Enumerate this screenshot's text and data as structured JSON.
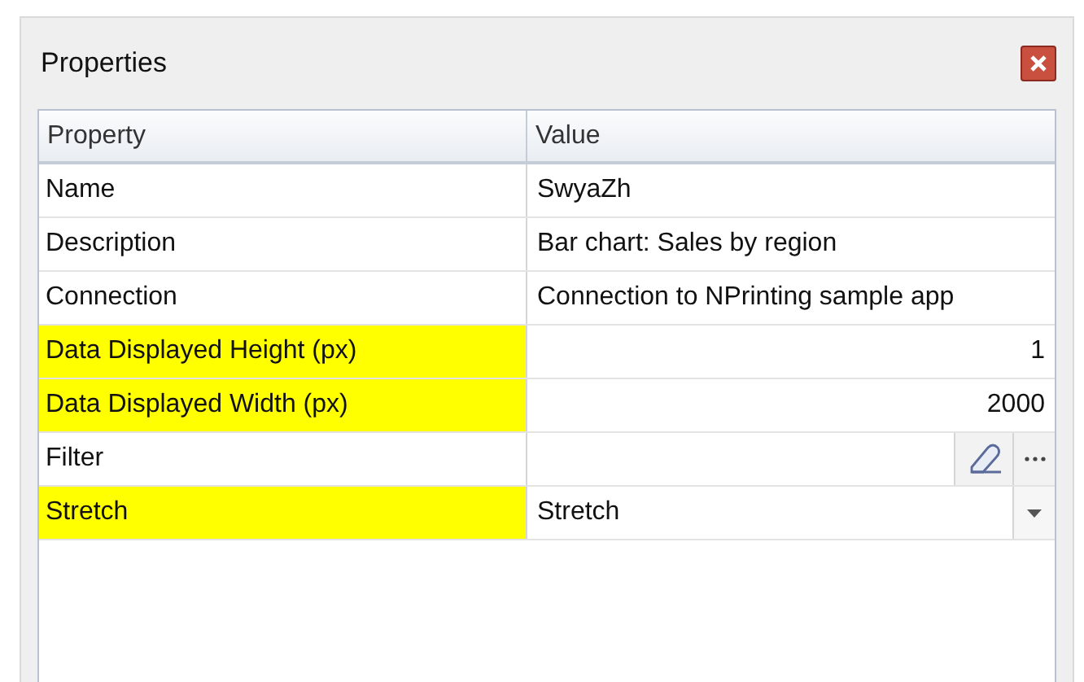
{
  "panel": {
    "title": "Properties"
  },
  "table": {
    "columns": [
      "Property",
      "Value"
    ],
    "rows": [
      {
        "kind": "text",
        "property": "Name",
        "value": "SwyaZh",
        "highlighted": false
      },
      {
        "kind": "text",
        "property": "Description",
        "value": "Bar chart: Sales by region",
        "highlighted": false
      },
      {
        "kind": "text",
        "property": "Connection",
        "value": "Connection to NPrinting sample app",
        "highlighted": false
      },
      {
        "kind": "number",
        "property": "Data Displayed Height (px)",
        "value": "1",
        "highlighted": true
      },
      {
        "kind": "number",
        "property": "Data Displayed Width (px)",
        "value": "2000",
        "highlighted": true
      },
      {
        "kind": "filter",
        "property": "Filter",
        "highlighted": false
      },
      {
        "kind": "dropdown",
        "property": "Stretch",
        "value": "Stretch",
        "highlighted": true
      }
    ]
  }
}
